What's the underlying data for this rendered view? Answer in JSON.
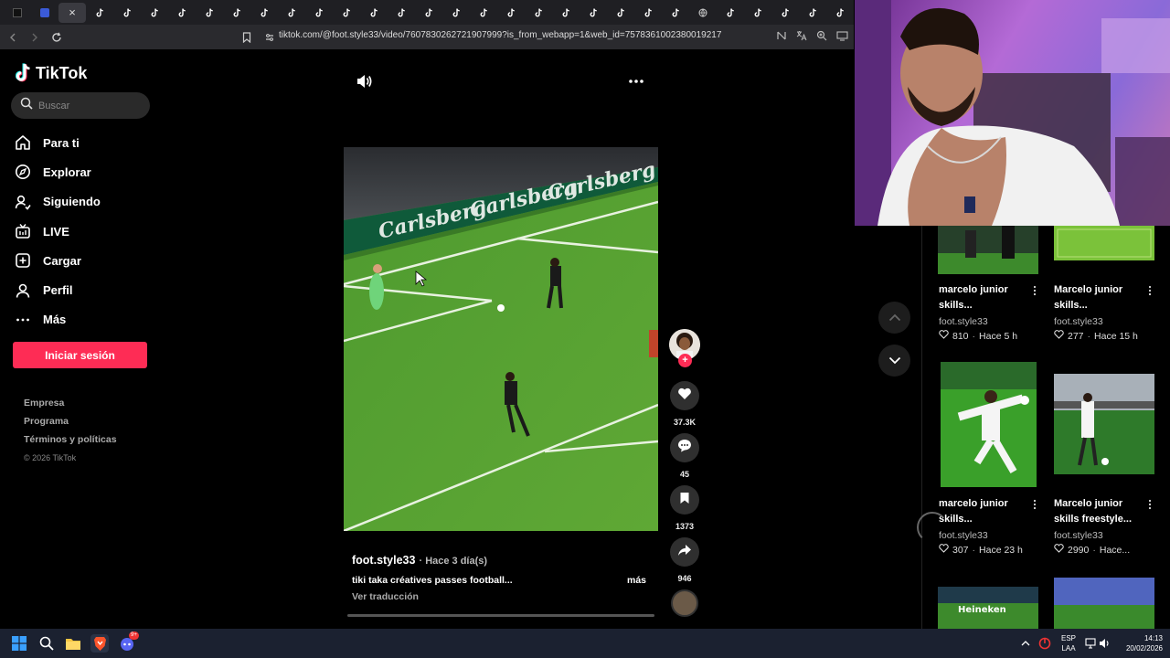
{
  "browser": {
    "url": "tiktok.com/@foot.style33/video/7607830262721907999?is_from_webapp=1&web_id=7578361002380019217",
    "tab_count": 31,
    "active_tab_index": 2,
    "close_glyph": "×"
  },
  "sidebar": {
    "logo_text": "TikTok",
    "search_placeholder": "Buscar",
    "nav_items": [
      {
        "label": "Para ti",
        "icon": "home-icon"
      },
      {
        "label": "Explorar",
        "icon": "compass-icon"
      },
      {
        "label": "Siguiendo",
        "icon": "following-icon"
      },
      {
        "label": "LIVE",
        "icon": "live-icon"
      },
      {
        "label": "Cargar",
        "icon": "upload-icon"
      },
      {
        "label": "Perfil",
        "icon": "profile-icon"
      },
      {
        "label": "Más",
        "icon": "more-dots-icon"
      }
    ],
    "login_label": "Iniciar sesión",
    "footer": {
      "company": "Empresa",
      "program": "Programa",
      "terms": "Términos y políticas",
      "copyright": "© 2026 TikTok"
    }
  },
  "video": {
    "author": "foot.style33",
    "time": "· Hace 3 día(s)",
    "description": "tiki taka créatives passes football...",
    "more_label": "más",
    "translate_label": "Ver traducción",
    "progress": 0.0,
    "board_text": "Carlsberg"
  },
  "actions": {
    "likes": "37.3K",
    "comments": "45",
    "saves": "1373",
    "shares": "946",
    "follow_glyph": "+"
  },
  "related": [
    {
      "title": "marcelo junior skills...",
      "author": "foot.style33",
      "likes": "810",
      "time": "Hace 5 h"
    },
    {
      "title": "Marcelo junior skills...",
      "author": "foot.style33",
      "likes": "277",
      "time": "Hace 15 h"
    },
    {
      "title": "marcelo junior skills...",
      "author": "foot.style33",
      "likes": "307",
      "time": "Hace 23 h"
    },
    {
      "title": "Marcelo junior skills freestyle...",
      "author": "foot.style33",
      "likes": "2990",
      "time": "Hace..."
    }
  ],
  "related_board_text": "Heineken",
  "taskbar": {
    "lang_top": "ESP",
    "lang_bottom": "LAA",
    "clock_time": "14:13",
    "clock_date": "20/02/2026",
    "discord_badge": "9+"
  },
  "colors": {
    "accent": "#fe2c55",
    "pitch": "#4a8a2e"
  }
}
